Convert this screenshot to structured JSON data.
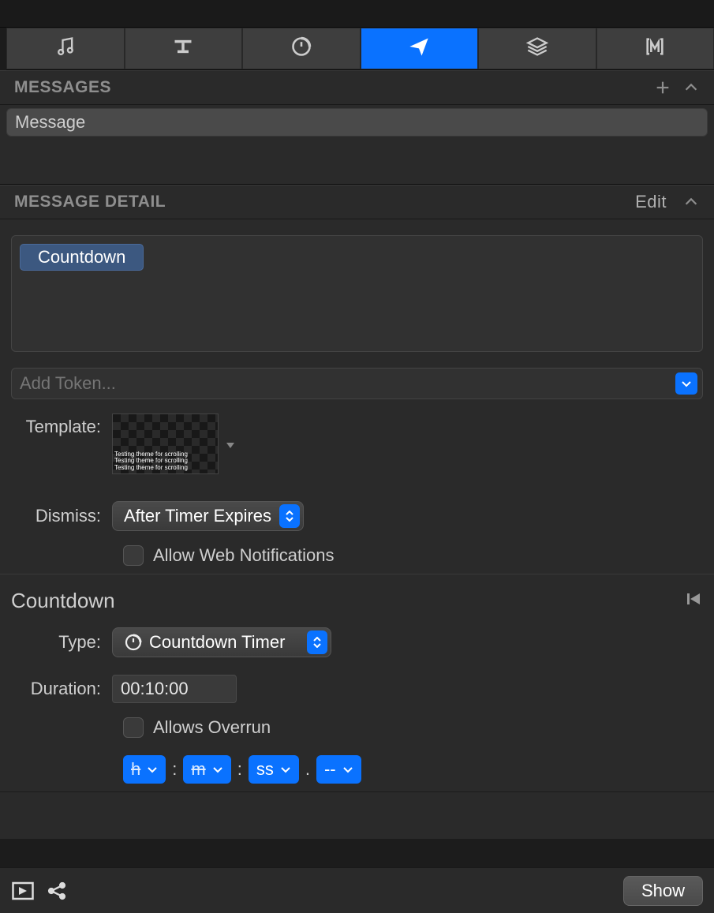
{
  "headers": {
    "messages": "MESSAGES",
    "message_detail": "MESSAGE DETAIL",
    "edit": "Edit"
  },
  "messages_list": {
    "items": [
      "Message"
    ]
  },
  "detail": {
    "token_chip": "Countdown",
    "add_token_placeholder": "Add Token...",
    "template_label": "Template:",
    "template_lines": [
      "Testing theme for scrolling",
      "Testing theme for scrolling",
      "Testing theme for scrolling"
    ],
    "dismiss_label": "Dismiss:",
    "dismiss_value": "After Timer Expires",
    "web_notifications": "Allow Web Notifications"
  },
  "countdown": {
    "title": "Countdown",
    "type_label": "Type:",
    "type_value": "Countdown Timer",
    "duration_label": "Duration:",
    "duration_value": "00:10:00",
    "allows_overrun": "Allows Overrun",
    "fmt": {
      "h": "h",
      "m": "m",
      "ss": "ss",
      "dash": "--",
      "sep1": ":",
      "sep2": ":",
      "sep3": "."
    }
  },
  "footer": {
    "show": "Show"
  }
}
